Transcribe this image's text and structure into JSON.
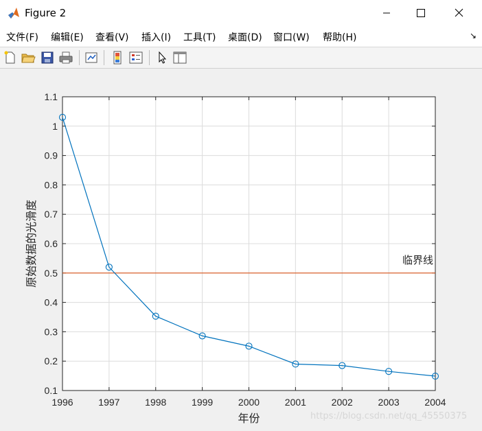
{
  "window": {
    "title": "Figure 2"
  },
  "menu": [
    {
      "label": "文件(F)"
    },
    {
      "label": "编辑(E)"
    },
    {
      "label": "查看(V)"
    },
    {
      "label": "插入(I)"
    },
    {
      "label": "工具(T)"
    },
    {
      "label": "桌面(D)"
    },
    {
      "label": "窗口(W)"
    },
    {
      "label": "帮助(H)"
    }
  ],
  "toolbar": [
    "new-figure-icon",
    "open-file-icon",
    "save-icon",
    "print-icon",
    "link-plot-icon",
    "colorbar-icon",
    "legend-icon",
    "cursor-icon",
    "property-inspector-icon"
  ],
  "colors": {
    "series": "#0072BD",
    "threshold": "#D95319",
    "grid": "#dcdcdc"
  },
  "chart_data": {
    "type": "line",
    "title": "",
    "xlabel": "年份",
    "ylabel": "原始数据的光滑度",
    "xlim": [
      1996,
      2004
    ],
    "ylim": [
      0.1,
      1.1
    ],
    "grid": true,
    "xticks": [
      "1996",
      "1997",
      "1998",
      "1999",
      "2000",
      "2001",
      "2002",
      "2003",
      "2004"
    ],
    "yticks": [
      "0.1",
      "0.2",
      "0.3",
      "0.4",
      "0.5",
      "0.6",
      "0.7",
      "0.8",
      "0.9",
      "1",
      "1.1"
    ],
    "series": [
      {
        "x": [
          1996,
          1997,
          1998,
          1999,
          2000,
          2001,
          2002,
          2003,
          2004
        ],
        "y": [
          1.03,
          0.52,
          0.353,
          0.286,
          0.251,
          0.19,
          0.185,
          0.165,
          0.149
        ],
        "marker": "circle"
      }
    ],
    "reference_line": {
      "y": 0.5,
      "label": "临界线"
    }
  },
  "watermark": "https://blog.csdn.net/qq_45550375"
}
